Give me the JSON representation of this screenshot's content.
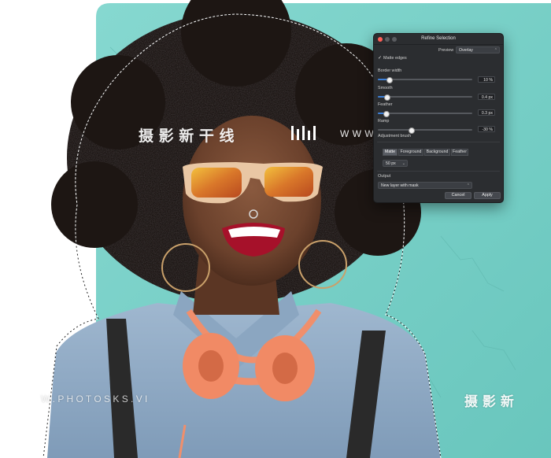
{
  "dialog": {
    "title": "Refine Selection",
    "preview": {
      "label": "Preview",
      "value": "Overlay"
    },
    "matte_edges": {
      "label": "Matte edges",
      "checked": true
    },
    "border_width": {
      "label": "Border width",
      "value": "10 %",
      "level": 0.1
    },
    "smooth": {
      "label": "Smooth",
      "value": "0.4 px",
      "level": 0.04
    },
    "feather": {
      "label": "Feather",
      "value": "0.3 px",
      "level": 0.03
    },
    "ramp": {
      "label": "Ramp",
      "value": "-30 %",
      "level": 0.35
    },
    "adjustment_brush": {
      "label": "Adjustment brush",
      "modes": [
        "Matte",
        "Foreground",
        "Background",
        "Feather"
      ],
      "active_mode": "Matte",
      "size": "50 px"
    },
    "output": {
      "label": "Output",
      "value": "New layer with mask"
    },
    "cancel_label": "Cancel",
    "apply_label": "Apply"
  },
  "watermark": {
    "cn": "摄 影 新 干 线",
    "url": "W W W . P H O T O S K S . V I P",
    "url_bottom": "W . P H O T O S K S . V I",
    "cn_bottom": "摄 影 新"
  },
  "colors": {
    "wall": "#7fd3cb",
    "accent": "#3d7fd6",
    "dialog_bg": "#2b2d30"
  }
}
